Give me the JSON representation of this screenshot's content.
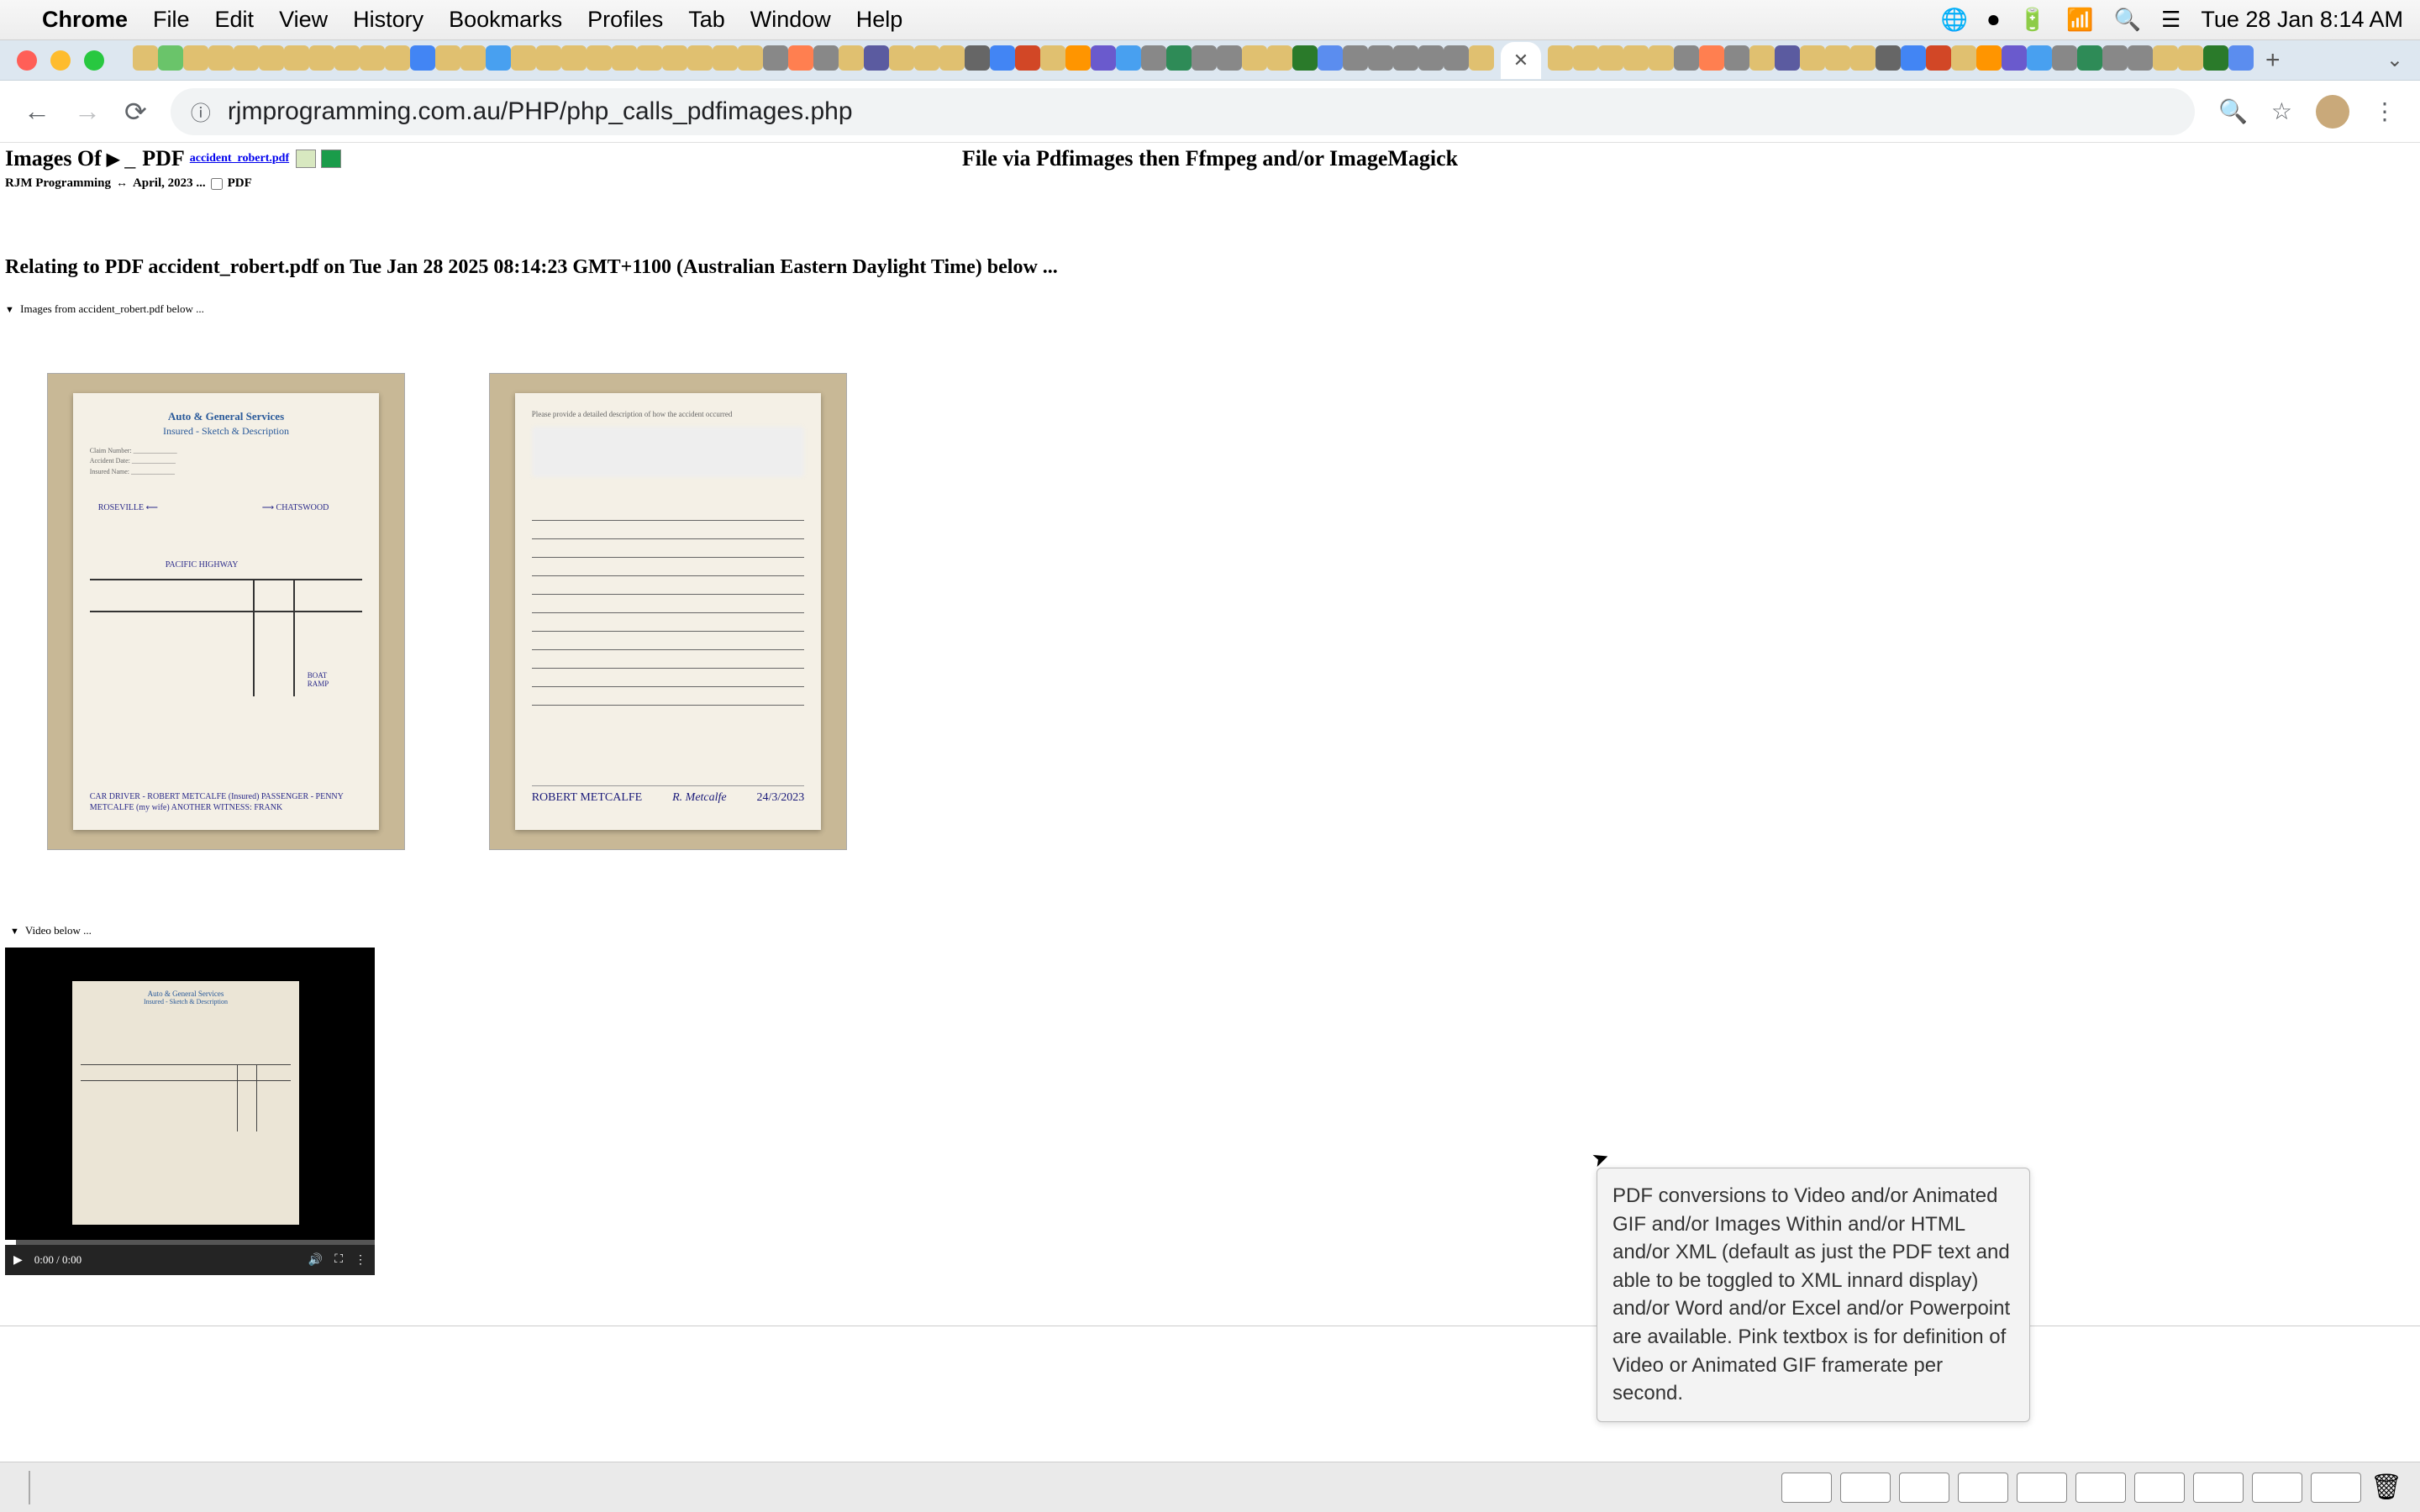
{
  "menubar": {
    "app": "Chrome",
    "items": [
      "File",
      "Edit",
      "View",
      "History",
      "Bookmarks",
      "Profiles",
      "Tab",
      "Window",
      "Help"
    ],
    "datetime": "Tue 28 Jan  8:14 AM"
  },
  "addressbar": {
    "url": "rjmprogramming.com.au/PHP/php_calls_pdfimages.php"
  },
  "page": {
    "title_left": "Images Of",
    "pdf_label": "PDF",
    "filelink": "accident_robert.pdf",
    "title_center": "File via Pdfimages then Ffmpeg and/or ImageMagick",
    "subhead_left": "RJM Programming",
    "subhead_mid": "April, 2023 ...",
    "subhead_right": "PDF",
    "relating": "Relating to PDF accident_robert.pdf on Tue Jan 28 2025 08:14:23 GMT+1100 (Australian Eastern Daylight Time) below ...",
    "details_images": "Images from accident_robert.pdf below ...",
    "details_video": "Video below ...",
    "doc1": {
      "title": "Auto & General Services",
      "subtitle": "Insured - Sketch & Description",
      "labels": [
        "ROSEVILLE",
        "CHATSWOOD",
        "PACIFIC HIGHWAY",
        "BOAT RAMP"
      ],
      "hand": "CAR\nDRIVER - ROBERT METCALFE (Insured)\nPASSENGER - PENNY METCALFE (my wife)\nANOTHER WITNESS: FRANK"
    },
    "doc2": {
      "sig_name": "ROBERT METCALFE",
      "sig_script": "R. Metcalfe",
      "sig_date": "24/3/2023"
    },
    "video": {
      "time": "0:00 / 0:00"
    },
    "tooltip": "PDF conversions to Video and/or Animated GIF and/or Images Within and/or HTML and/or XML (default as just the PDF text and able to be toggled to XML innard display) and/or Word and/or Excel and/or Powerpoint are available.  Pink textbox is for definition of Video or Animated GIF framerate per second."
  },
  "dock_colors": [
    "#1e90ff",
    "#ff3b30",
    "#ffd966",
    "#d8d8d8",
    "#34c3ff",
    "#2aa6ff",
    "#34c759",
    "#8e8e93",
    "#ff9500",
    "#ff6f61",
    "#34c759",
    "#ff9500",
    "#ffffff",
    "#ff2d55",
    "#0071e3",
    "#8b1a1a",
    "#ff3b30",
    "#8e8e93",
    "#0071e3",
    "#ff3b30",
    "#000000",
    "#0071e3",
    "#5856d6",
    "#5ac8fa",
    "#0a3d62",
    "#5856d6",
    "#8e8e93",
    "#8e8e93",
    "#ff9500",
    "#0a0a0a",
    "#ff3131",
    "#8e8e93",
    "#8e8e93",
    "#0071e3",
    "#1e90ff",
    "#ff9500",
    "#0071e3",
    "#8e8e93",
    "#34c759",
    "#5ac8fa",
    "#ff3b30",
    "#aa0000",
    "#0071e3",
    "#ff9f0a",
    "#ba68c8",
    "#000000",
    "#34c759",
    "#0071e3",
    "#ff3b30",
    "#0071e3",
    "#7a7a7a"
  ]
}
